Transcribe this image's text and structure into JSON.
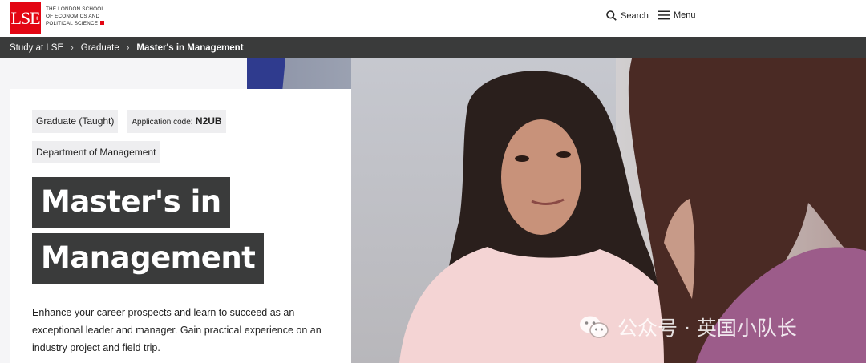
{
  "header": {
    "logo_mark": "LSE",
    "logo_lines": [
      "THE LONDON SCHOOL",
      "OF ECONOMICS AND",
      "POLITICAL SCIENCE"
    ],
    "search_label": "Search",
    "menu_label": "Menu",
    "brand_color": "#e30613"
  },
  "breadcrumb": {
    "items": [
      "Study at LSE",
      "Graduate",
      "Master's in Management"
    ]
  },
  "card": {
    "tag_level": "Graduate (Taught)",
    "application_code_label": "Application code:",
    "application_code": "N2UB",
    "department": "Department of Management",
    "title_lines": [
      "Master's in",
      "Management"
    ],
    "description": "Enhance your career prospects and learn to succeed as an exceptional leader and manager. Gain practical experience on an industry project and field trip."
  },
  "watermark": {
    "text": "公众号 · 英国小队长",
    "icon": "wechat-icon"
  }
}
